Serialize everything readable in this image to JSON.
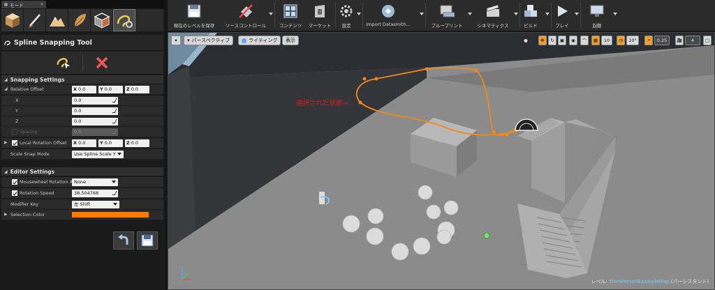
{
  "modes_tab": {
    "title": "モード",
    "close": "×"
  },
  "tool": {
    "title": "Spline Snapping Tool"
  },
  "snapping": {
    "header": "Snapping Settings",
    "relative_offset": {
      "label": "Relative Offset",
      "x": "0.0",
      "y": "0.0",
      "z": "0.0"
    },
    "x_label": "X",
    "x_value": "0.0",
    "y_label": "Y",
    "y_value": "0.0",
    "z_label": "Z",
    "z_value": "0.0",
    "spacing": {
      "label": "Spacing",
      "value": "0.0",
      "checked": false,
      "enabled": false
    },
    "local_rotation_offset": {
      "label": "Local Rotation Offset",
      "checked": true,
      "x": "0.0",
      "y": "0.0",
      "z": "0.0"
    },
    "scale_snap_mode": {
      "label": "Scale Snap Mode",
      "value": "Use Spline Scale Y"
    }
  },
  "editor": {
    "header": "Editor Settings",
    "mousewheel_rotation": {
      "label": "Mousewheel Rotation A",
      "checked": true,
      "value": "None"
    },
    "rotation_speed": {
      "label": "Rotation Speed",
      "checked": true,
      "value": "38.504768"
    },
    "modifier_key": {
      "label": "Modifier Key",
      "value": "左 Shift"
    },
    "selection_color": {
      "label": "Selection Color",
      "color": "#ff7a00"
    }
  },
  "toolbar": {
    "save": "現在のレベルを保存",
    "source_control": "ソースコントロール",
    "content": "コンテンツ",
    "marketplace": "マーケット",
    "settings": "設定",
    "datasmith": "Import Datasmith...",
    "blueprints": "ブループリント",
    "cinematics": "シネマティクス",
    "build": "ビルド",
    "play": "プレイ",
    "launch": "起動"
  },
  "viewport": {
    "perspective": "パースペクティブ",
    "lighting": "ライティング",
    "show": "表示",
    "grid_snap": "10",
    "rot_snap": "10°",
    "scale_snap": "0.25",
    "camera_speed": "4",
    "annotation": "選択された状態→",
    "level_prefix": "レベル:",
    "level_name": "ThirdPersonExampleMap",
    "level_suffix": "(パーシスタント)"
  },
  "colors": {
    "accent": "#ff7a00",
    "annotation": "#e21a1a",
    "spline": "#f08a1c"
  }
}
